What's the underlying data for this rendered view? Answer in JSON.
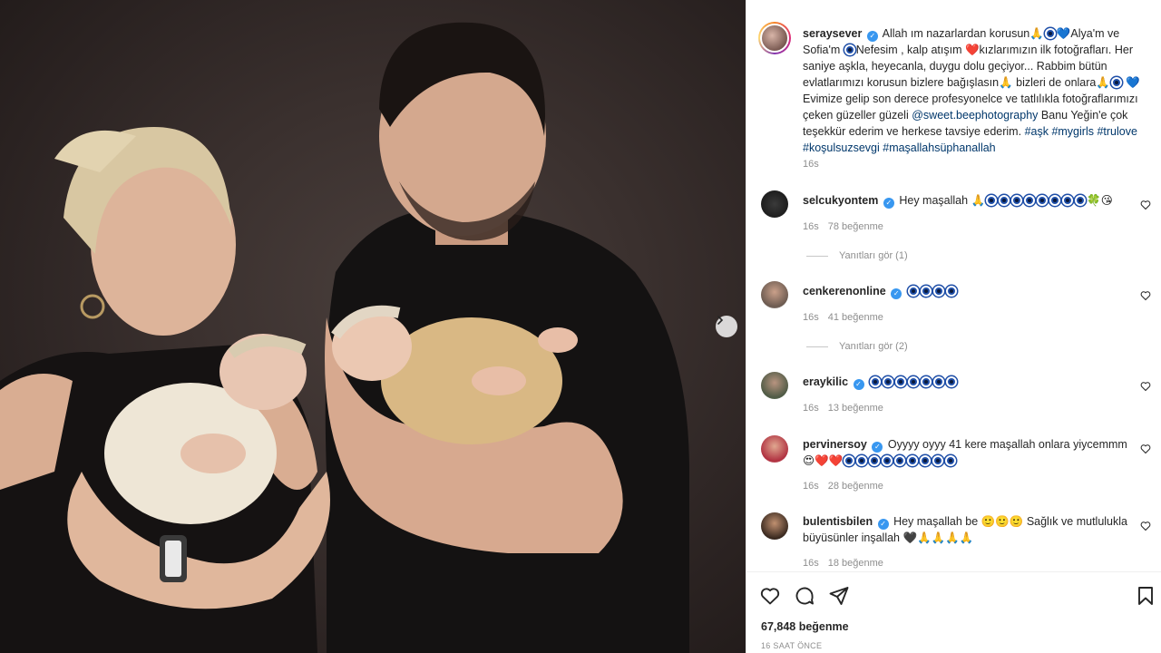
{
  "post": {
    "author": "seraysever",
    "caption_parts": {
      "p1": "Allah ım nazarlardan korusun",
      "p2": "Alya'm ve Sofia'm",
      "p3": "Nefesim , kalp atışım",
      "p4": "kızlarımızın ilk fotoğrafları. Her saniye aşkla, heyecanla, duygu dolu geçiyor... Rabbim bütün evlatlarımızı korusun bizlere bağışlasın",
      "p5": "bizleri de onlara",
      "p6": "Evimize gelip son derece profesyonelce ve tatlılıkla fotoğraflarımızı çeken güzeller güzeli",
      "mention": "@sweet.beephotography",
      "p7": "Banu Yeğin'e çok teşekkür ederim ve herkese tavsiye ederim.",
      "tags": "#aşk #mygirls #trulove #koşulsuzsevgi #maşallahsüphanallah"
    },
    "age": "16s"
  },
  "comments": [
    {
      "user": "selcukyontem",
      "text": "Hey maşallah",
      "age": "16s",
      "likes": "78 beğenme",
      "replies": "Yanıtları gör (1)"
    },
    {
      "user": "cenkerenonline",
      "text": "",
      "age": "16s",
      "likes": "41 beğenme",
      "replies": "Yanıtları gör (2)"
    },
    {
      "user": "eraykilic",
      "text": "",
      "age": "16s",
      "likes": "13 beğenme"
    },
    {
      "user": "pervinersoy",
      "text": "Oyyyy oyyy 41 kere maşallah onlara yiycemmm",
      "age": "16s",
      "likes": "28 beğenme"
    },
    {
      "user": "bulentisbilen",
      "text": "Hey maşallah be",
      "text2": "Sağlık ve mutlulukla büyüsünler inşallah",
      "age": "16s",
      "likes": "18 beğenme"
    }
  ],
  "footer": {
    "likes": "67,848 beğenme",
    "time": "16 SAAT ÖNCE"
  },
  "colors": {
    "verified": "#3897f0",
    "link": "#00376b",
    "muted": "#8e8e8e"
  }
}
